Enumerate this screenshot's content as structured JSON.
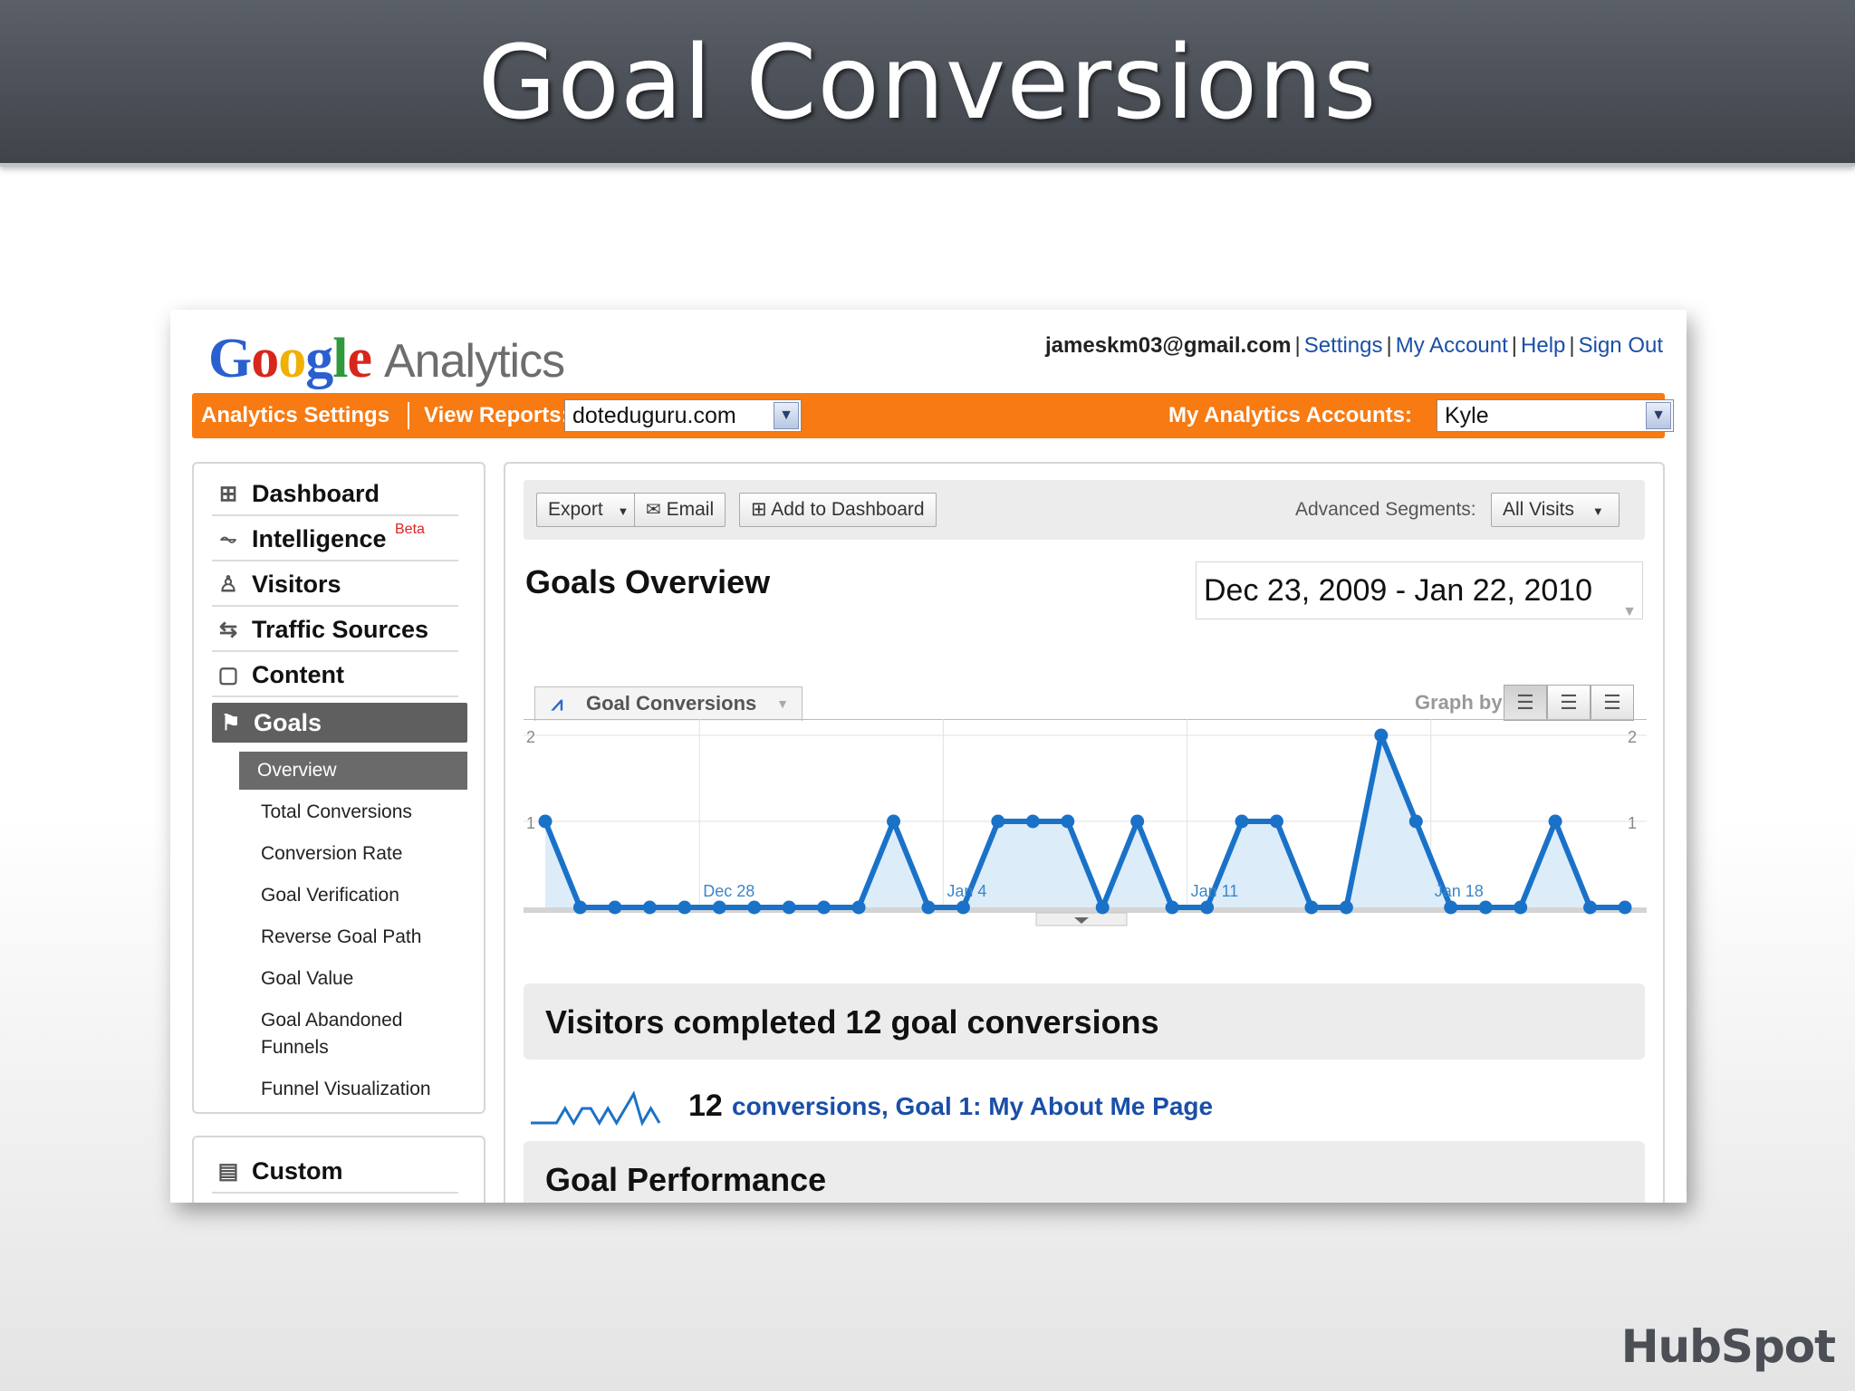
{
  "slide": {
    "title": "Goal Conversions",
    "brand": "HubSpot"
  },
  "header": {
    "logo_google": "Google",
    "logo_analytics": "Analytics",
    "user_email": "jameskm03@gmail.com",
    "links": [
      "Settings",
      "My Account",
      "Help",
      "Sign Out"
    ]
  },
  "orange_bar": {
    "settings_label": "Analytics Settings",
    "view_reports_label": "View Reports:",
    "site_value": "doteduguru.com",
    "accounts_label": "My Analytics Accounts:",
    "account_value": "Kyle"
  },
  "sidebar": {
    "items": [
      {
        "label": "Dashboard",
        "icon": "grid-icon"
      },
      {
        "label": "Intelligence",
        "icon": "pulse-icon",
        "badge": "Beta"
      },
      {
        "label": "Visitors",
        "icon": "person-icon"
      },
      {
        "label": "Traffic Sources",
        "icon": "routes-icon"
      },
      {
        "label": "Content",
        "icon": "page-icon"
      },
      {
        "label": "Goals",
        "icon": "flag-icon",
        "active": true
      }
    ],
    "goal_subitems": [
      "Overview",
      "Total Conversions",
      "Conversion Rate",
      "Goal Verification",
      "Reverse Goal Path",
      "Goal Value",
      "Goal Abandoned",
      "Funnels",
      "Funnel Visualization"
    ],
    "custom_label": "Custom"
  },
  "toolbar": {
    "export_label": "Export",
    "email_label": "Email",
    "add_dashboard_label": "Add to Dashboard",
    "segments_label": "Advanced Segments:",
    "segments_value": "All Visits"
  },
  "main": {
    "title": "Goals Overview",
    "date_range": "Dec 23, 2009 - Jan 22, 2010",
    "metric_tab": "Goal Conversions",
    "graph_by_label": "Graph by:",
    "summary": "Visitors completed 12 goal conversions",
    "goal_count": "12",
    "goal_link": "conversions, Goal 1: My About Me Page",
    "performance_title": "Goal Performance"
  },
  "chart_data": {
    "type": "area",
    "series": [
      {
        "name": "Goal Conversions",
        "values": [
          1,
          0,
          0,
          0,
          0,
          0,
          0,
          0,
          0,
          0,
          1,
          0,
          0,
          1,
          1,
          1,
          0,
          1,
          0,
          0,
          1,
          1,
          0,
          0,
          2,
          1,
          0,
          0,
          0,
          1,
          0,
          0
        ]
      }
    ],
    "x_tick_labels": [
      {
        "label": "Dec 28",
        "index": 5
      },
      {
        "label": "Jan 4",
        "index": 12
      },
      {
        "label": "Jan 11",
        "index": 19
      },
      {
        "label": "Jan 18",
        "index": 26
      }
    ],
    "y_ticks_left": [
      "2",
      "1"
    ],
    "y_ticks_right": [
      "2",
      "1"
    ],
    "ylim": [
      0,
      2
    ],
    "grid": true,
    "color": "#1a72c8",
    "fill": "#dcecf8"
  },
  "sparkline": [
    0,
    0,
    0,
    0,
    1,
    0,
    1,
    1,
    0,
    1,
    0,
    1,
    2,
    0,
    1,
    0
  ]
}
